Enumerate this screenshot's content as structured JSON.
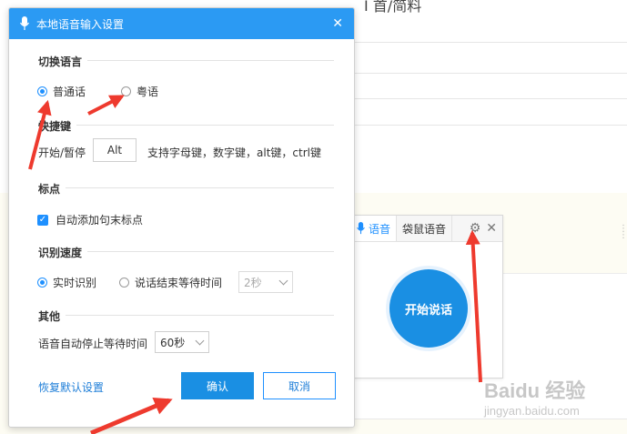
{
  "background": {
    "doc_title": "I 首/简料"
  },
  "dialog": {
    "title": "本地语音输入设置",
    "sections": {
      "language": "切换语言",
      "hotkey": "快捷键",
      "punctuation": "标点",
      "speed": "识别速度",
      "other": "其他"
    },
    "language": {
      "option1": "普通话",
      "option2": "粤语",
      "selected": "普通话"
    },
    "hotkey": {
      "label": "开始/暂停",
      "value": "Alt",
      "hint": "支持字母键，数字键，alt键，ctrl键"
    },
    "punctuation": {
      "auto_label": "自动添加句末标点",
      "checked": true
    },
    "speed": {
      "option1": "实时识别",
      "option2": "说话结束等待时间",
      "wait_value": "2秒",
      "selected": "实时识别"
    },
    "other": {
      "label": "语音自动停止等待时间",
      "value": "60秒"
    },
    "restore_link": "恢复默认设置",
    "confirm": "确认",
    "cancel": "取消"
  },
  "voice_panel": {
    "tab_voice": "语音",
    "tab_kangaroo": "袋鼠语音",
    "start_button": "开始说话"
  },
  "watermark": {
    "logo": "Baidu 经验",
    "sub": "jingyan.baidu.com"
  },
  "colors": {
    "accent": "#1a8fe3",
    "titlebar": "#2b9af3",
    "annotation_arrow": "#ee3a2e"
  }
}
